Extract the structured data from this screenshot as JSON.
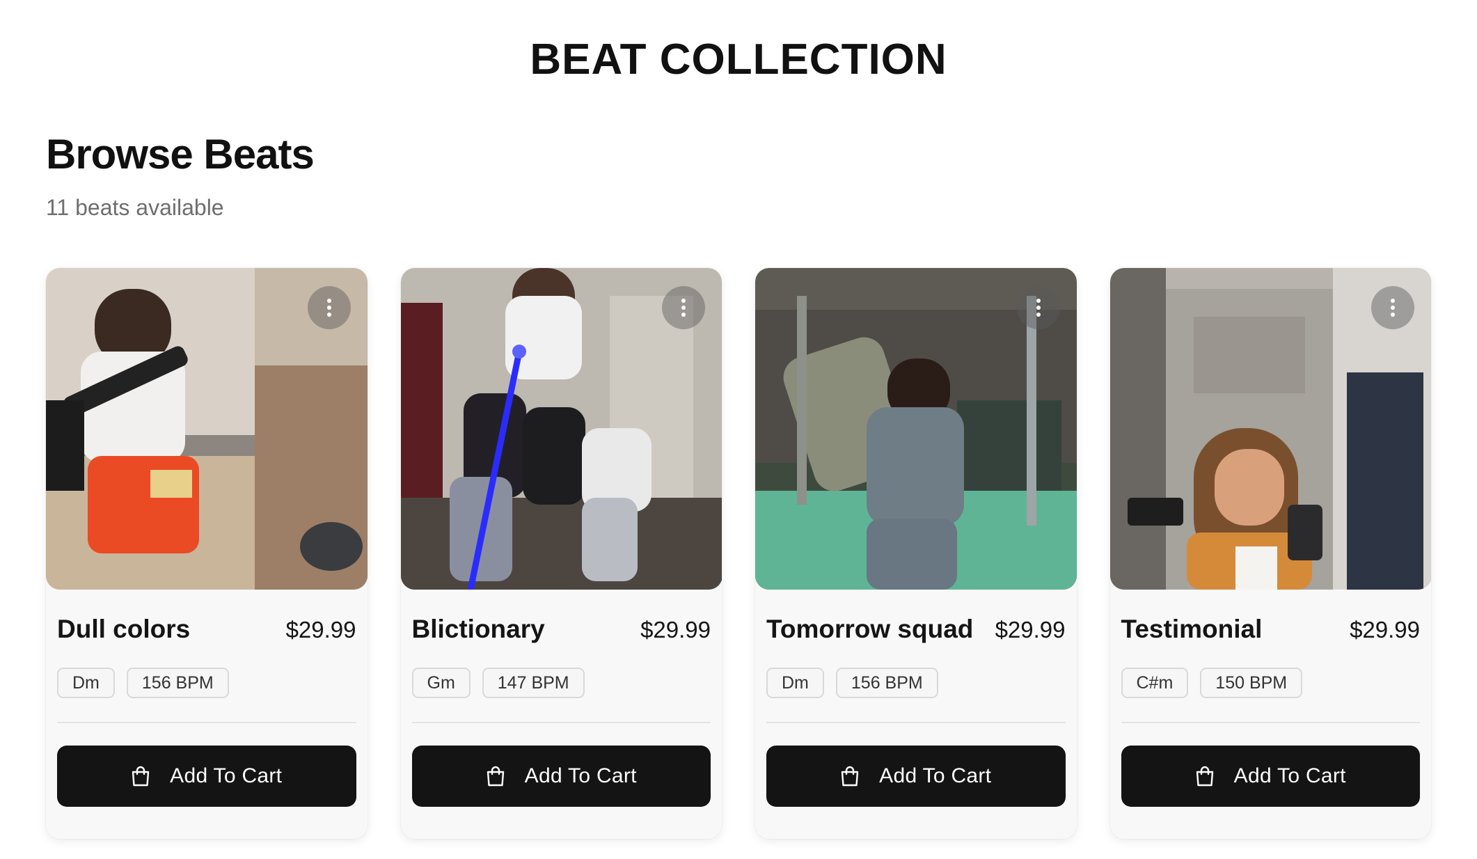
{
  "page": {
    "title": "BEAT COLLECTION",
    "heading": "Browse Beats",
    "count_text": "11 beats available"
  },
  "beats": [
    {
      "title": "Dull colors",
      "price": "$29.99",
      "key": "Dm",
      "bpm": "156 BPM",
      "cta": "Add To Cart",
      "artwork": "Photo: young man in red shorts holding a rifle, seated on a kitchen counter with a dog nearby"
    },
    {
      "title": "Blictionary",
      "price": "$29.99",
      "key": "Gm",
      "bpm": "147 BPM",
      "cta": "Add To Cart",
      "artwork": "Photo: group of young men posing indoors with a blue laser beam"
    },
    {
      "title": "Tomorrow squad",
      "price": "$29.99",
      "key": "Dm",
      "bpm": "156 BPM",
      "cta": "Add To Cart",
      "artwork": "Photo: man in grey sweatsuit holding large bags in a green-lit warehouse"
    },
    {
      "title": "Testimonial",
      "price": "$29.99",
      "key": "C#m",
      "bpm": "150 BPM",
      "cta": "Add To Cart",
      "artwork": "Photo: woman taking a mirror selfie holding a handgun"
    }
  ],
  "icons": {
    "menu": "more-vertical-icon",
    "cart": "shopping-bag-icon"
  },
  "colors": {
    "button_bg": "#141414",
    "button_text": "#ffffff",
    "card_bg": "#f8f8f8",
    "muted_text": "#6e6e6e"
  }
}
